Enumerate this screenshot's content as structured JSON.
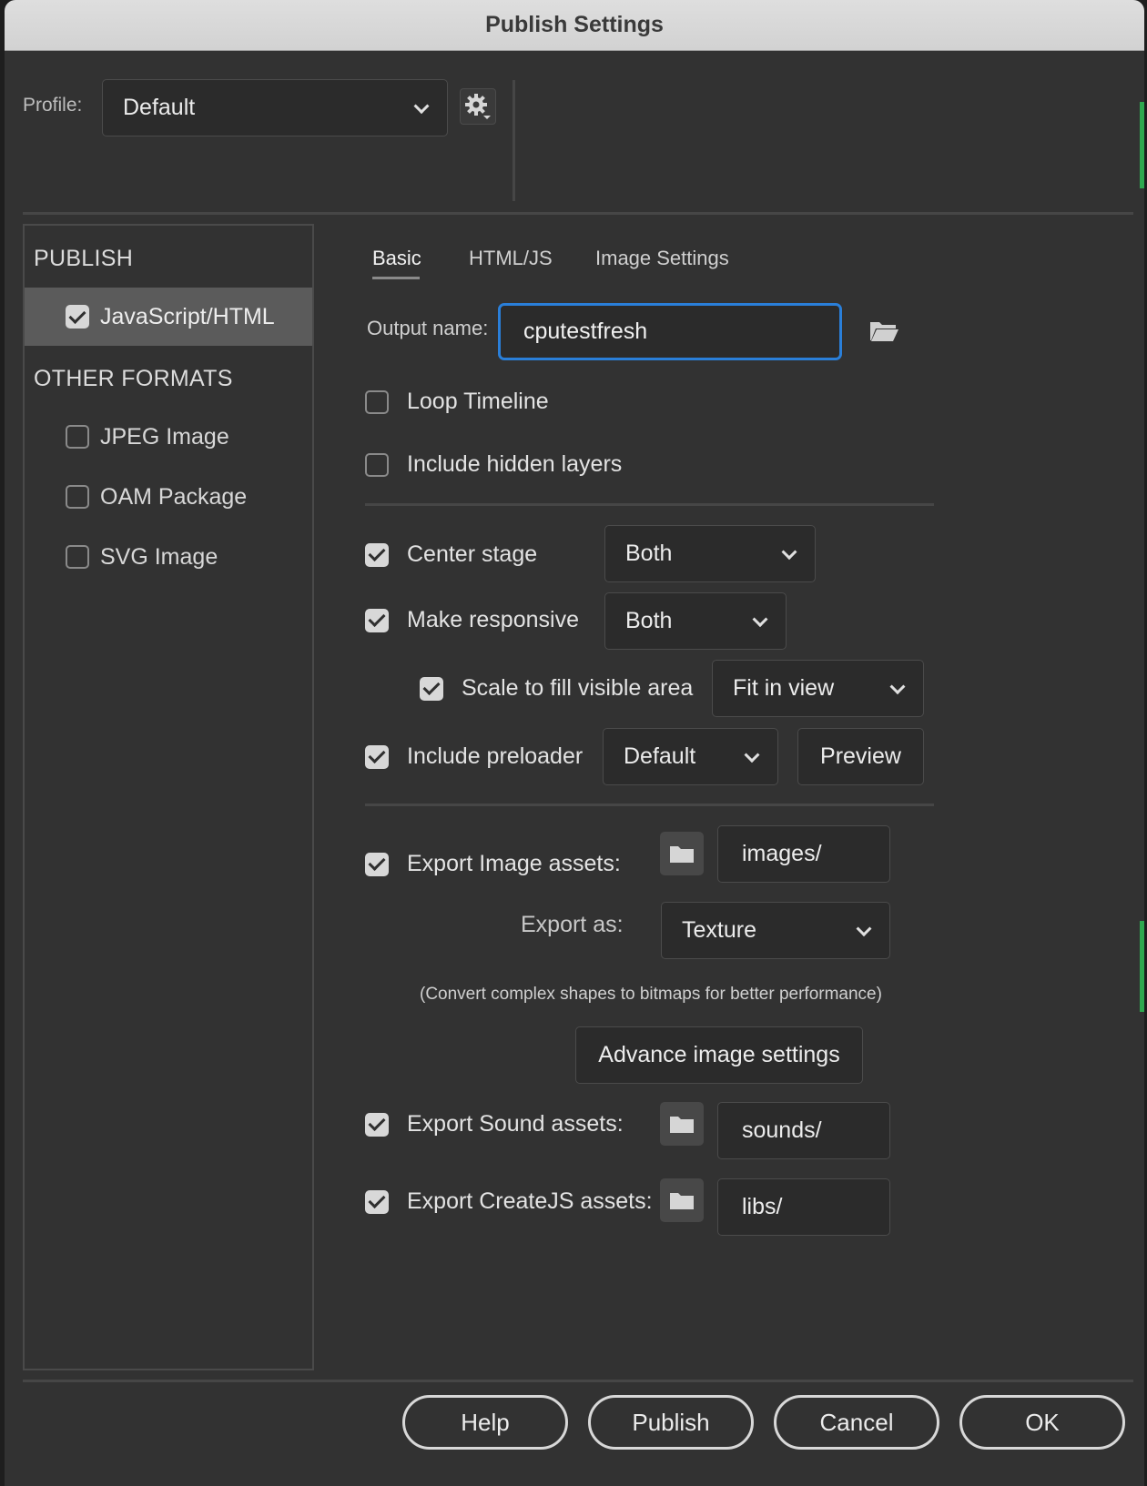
{
  "window": {
    "title": "Publish Settings"
  },
  "profile": {
    "label": "Profile:",
    "value": "Default"
  },
  "left_panel": {
    "publish_heading": "PUBLISH",
    "publish_items": [
      {
        "label": "JavaScript/HTML",
        "checked": true
      }
    ],
    "other_heading": "OTHER FORMATS",
    "other_items": [
      {
        "label": "JPEG Image",
        "checked": false
      },
      {
        "label": "OAM Package",
        "checked": false
      },
      {
        "label": "SVG Image",
        "checked": false
      }
    ]
  },
  "tabs": [
    {
      "label": "Basic",
      "active": true
    },
    {
      "label": "HTML/JS",
      "active": false
    },
    {
      "label": "Image Settings",
      "active": false
    }
  ],
  "basic": {
    "output_label": "Output name:",
    "output_value": "cputestfresh",
    "loop_timeline": {
      "label": "Loop Timeline",
      "checked": false
    },
    "include_hidden_layers": {
      "label": "Include hidden layers",
      "checked": false
    },
    "center_stage": {
      "label": "Center stage",
      "checked": true,
      "value": "Both"
    },
    "make_responsive": {
      "label": "Make responsive",
      "checked": true,
      "value": "Both"
    },
    "scale_to_fill": {
      "label": "Scale to fill visible area",
      "checked": true,
      "value": "Fit in view"
    },
    "include_preloader": {
      "label": "Include preloader",
      "checked": true,
      "value": "Default",
      "preview_label": "Preview"
    },
    "export_image_assets": {
      "label": "Export Image assets:",
      "checked": true,
      "path": "images/"
    },
    "export_as": {
      "label": "Export as:",
      "value": "Texture"
    },
    "hint": "(Convert complex shapes to bitmaps for better performance)",
    "advance_button": "Advance image settings",
    "export_sound_assets": {
      "label": "Export Sound assets:",
      "checked": true,
      "path": "sounds/"
    },
    "export_createjs_assets": {
      "label": "Export CreateJS assets:",
      "checked": true,
      "path": "libs/"
    }
  },
  "footer": {
    "help": "Help",
    "publish": "Publish",
    "cancel": "Cancel",
    "ok": "OK"
  },
  "colors": {
    "accent_focus": "#2a7fd9",
    "right_edge_accent": "#2fa84f",
    "panel_bg": "#323232"
  }
}
